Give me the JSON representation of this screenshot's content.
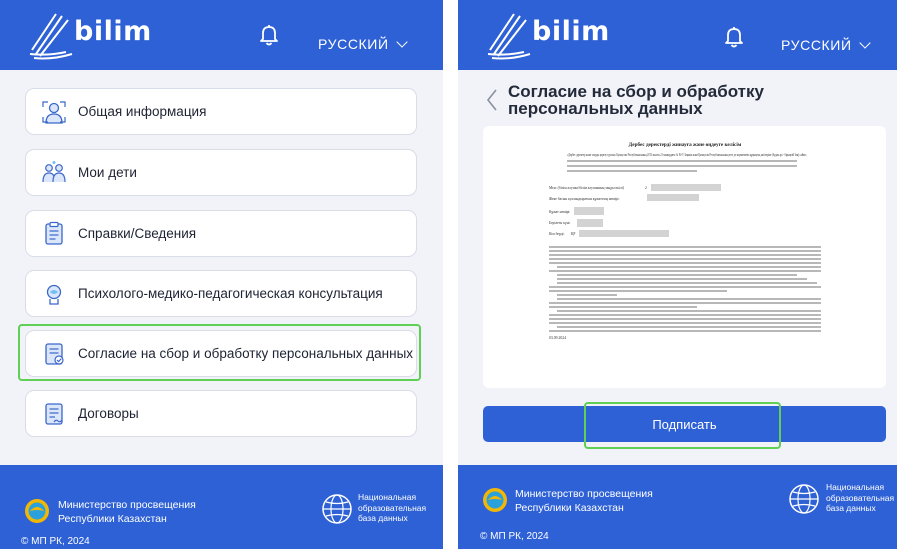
{
  "app": {
    "logo_text": "bilim",
    "language": "РУССКИЙ"
  },
  "menu": {
    "items": [
      {
        "label": "Общая информация",
        "icon": "info-person-icon"
      },
      {
        "label": "Мои дети",
        "icon": "children-icon"
      },
      {
        "label": "Справки/Сведения",
        "icon": "document-icon"
      },
      {
        "label": "Психолого-медико-педагогическая консультация",
        "icon": "consultation-icon"
      },
      {
        "label": "Согласие на сбор и обработку персональных данных",
        "icon": "consent-document-icon"
      },
      {
        "label": "Договоры",
        "icon": "contract-icon"
      }
    ]
  },
  "consent": {
    "title": "Согласие на сбор и обработку персональных данных",
    "sign_label": "Подписать",
    "document": {
      "heading": "Дербес деректерді жинауға және өңдеуге келісім",
      "intro": "«Дербес деректер және оларды қорғау туралы» Қазақстан Республикасының 2013 жылғы 21 мамырдағы № 94-V Заңына және Қазақстан Республикасының өзге де нормативтік құқықтық актілеріне (бұдан әрі - бірыңғай Заң) сәйкес,",
      "fields": [
        "Мен: (білім алушы/білім алушының заңды өкілі)",
        "Жеке басын куәландыратын құжаттың нөмірі:",
        "Құжат нөмірі:",
        "Берілген күні:",
        "Кім берді:"
      ],
      "field_values": [
        "2",
        "",
        "",
        "",
        "ҚР"
      ],
      "date": "03.09.2024"
    }
  },
  "footer": {
    "ministry_line1": "Министерство просвещения",
    "ministry_line2": "Республики Казахстан",
    "nedb_line1": "Национальная",
    "nedb_line2": "образовательная",
    "nedb_line3": "база данных",
    "copyright": "© МП РК, 2024"
  },
  "colors": {
    "primary": "#2e61d6",
    "background": "#f1f3f8",
    "highlight": "#5fcf55",
    "text": "#232a3a"
  }
}
